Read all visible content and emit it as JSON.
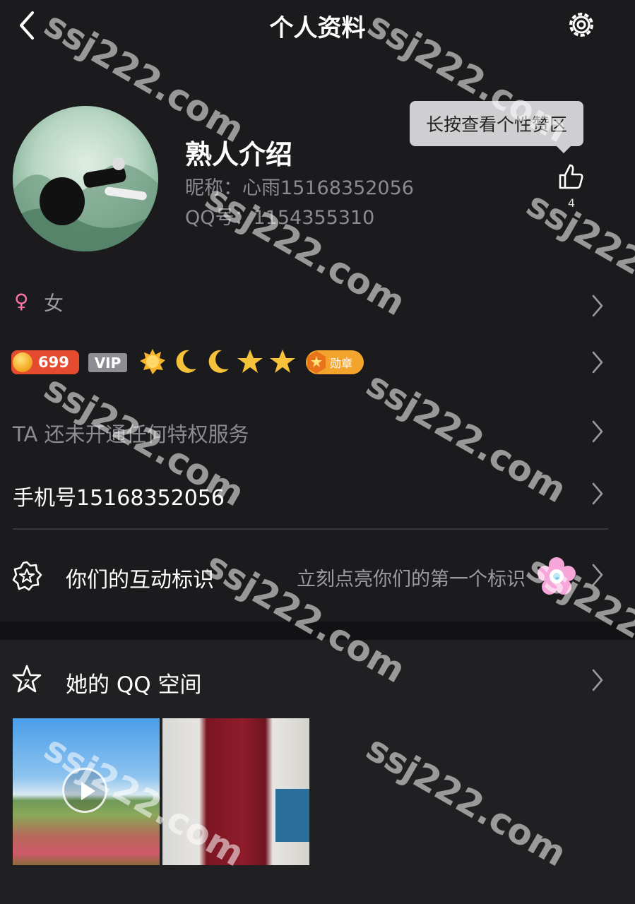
{
  "header": {
    "title": "个人资料"
  },
  "profile": {
    "name": "熟人介绍",
    "nickname": "昵称：心雨15168352056",
    "qq": "QQ号：1154355310"
  },
  "tooltip": "长按查看个性赞区",
  "likes": "4",
  "gender": "女",
  "badges": {
    "coin_level": "699",
    "vip": "VIP",
    "medal": "勋章"
  },
  "privilege": "TA 还未开通任何特权服务",
  "phone": "手机号15168352056",
  "interaction": {
    "label": "你们的互动标识",
    "hint": "立刻点亮你们的第一个标识"
  },
  "qzone": {
    "label": "她的 QQ 空间"
  },
  "watermark": "ssj222.com",
  "colors": {
    "background": "#1b1b1d",
    "coin": "#e54b2e",
    "medal": "#f2a42c",
    "gender": "#ff6fa8"
  }
}
